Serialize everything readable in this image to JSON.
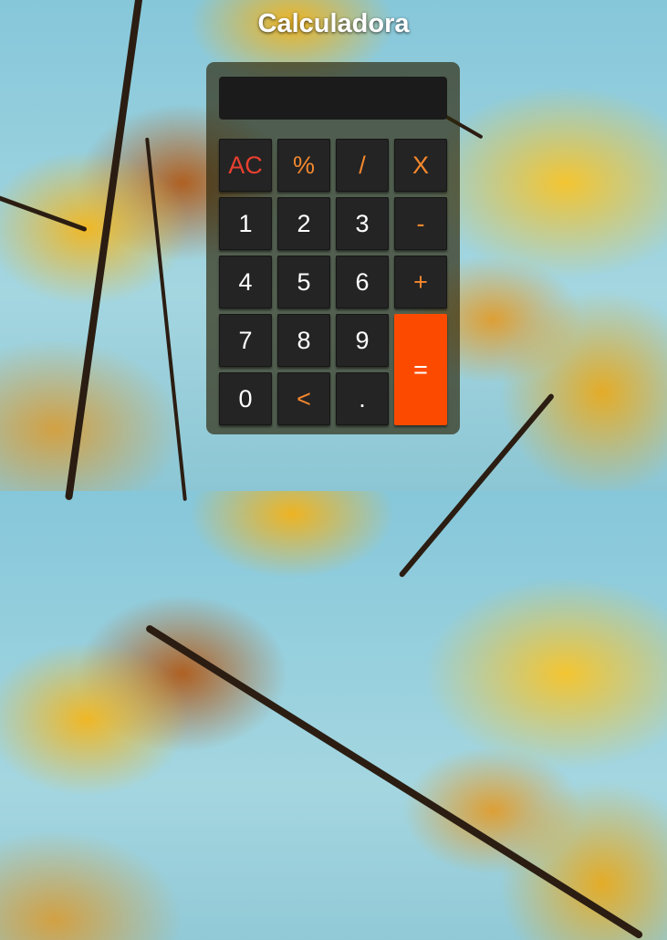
{
  "app": {
    "title": "Calculadora"
  },
  "display": {
    "value": ""
  },
  "keys": {
    "clear": "AC",
    "percent": "%",
    "divide": "/",
    "multiply": "X",
    "one": "1",
    "two": "2",
    "three": "3",
    "minus": "-",
    "four": "4",
    "five": "5",
    "six": "6",
    "plus": "+",
    "seven": "7",
    "eight": "8",
    "nine": "9",
    "equals": "=",
    "zero": "0",
    "backspace": "<",
    "decimal": "."
  },
  "colors": {
    "operator": "#f5882d",
    "clear": "#e84030",
    "equals_bg": "#fc4b00",
    "key_bg": "#242424",
    "display_bg": "#1b1b1b"
  }
}
